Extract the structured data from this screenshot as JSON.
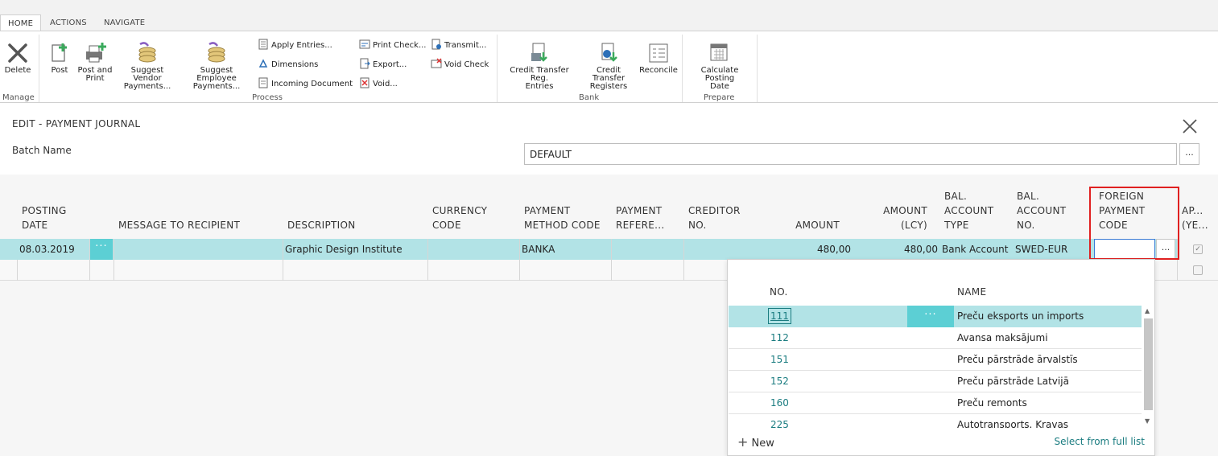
{
  "ribbon": {
    "tabs": [
      {
        "label": "HOME",
        "active": true
      },
      {
        "label": "ACTIONS",
        "active": false
      },
      {
        "label": "NAVIGATE",
        "active": false
      }
    ],
    "groups": {
      "manage": "Manage",
      "process": "Process",
      "bank": "Bank",
      "prepare": "Prepare"
    },
    "buttons": {
      "delete": "Delete",
      "post": "Post",
      "post_and_print_1": "Post and",
      "post_and_print_2": "Print",
      "suggest_vendor_1": "Suggest Vendor",
      "suggest_vendor_2": "Payments...",
      "suggest_employee_1": "Suggest Employee",
      "suggest_employee_2": "Payments...",
      "apply_entries": "Apply Entries...",
      "dimensions": "Dimensions",
      "incoming_document": "Incoming Document",
      "print_check": "Print Check...",
      "export": "Export...",
      "void": "Void...",
      "transmit": "Transmit...",
      "void_check": "Void Check",
      "credit_transfer_reg_entries_1": "Credit Transfer Reg.",
      "credit_transfer_reg_entries_2": "Entries",
      "credit_transfer_registers_1": "Credit Transfer",
      "credit_transfer_registers_2": "Registers",
      "reconcile": "Reconcile",
      "calculate_posting_date_1": "Calculate Posting",
      "calculate_posting_date_2": "Date"
    }
  },
  "page": {
    "title": "EDIT - PAYMENT JOURNAL",
    "batch_label": "Batch Name",
    "batch_value": "DEFAULT",
    "lookup_label": "..."
  },
  "grid": {
    "headers": {
      "posting_date_1": "POSTING",
      "posting_date_2": "DATE",
      "message": "MESSAGE TO RECIPIENT",
      "description": "DESCRIPTION",
      "currency_1": "CURRENCY",
      "currency_2": "CODE",
      "payment_method_1": "PAYMENT",
      "payment_method_2": "METHOD CODE",
      "payment_ref_1": "PAYMENT",
      "payment_ref_2": "REFERE...",
      "creditor_1": "CREDITOR",
      "creditor_2": "NO.",
      "amount": "AMOUNT",
      "amount_lcy_1": "AMOUNT",
      "amount_lcy_2": "(LCY)",
      "bal_type_1": "BAL.",
      "bal_type_2": "ACCOUNT",
      "bal_type_3": "TYPE",
      "bal_no_1": "BAL.",
      "bal_no_2": "ACCOUNT",
      "bal_no_3": "NO.",
      "fpc_1": "FOREIGN",
      "fpc_2": "PAYMENT",
      "fpc_3": "CODE",
      "ap_1": "AP...",
      "ap_2": "(YE..."
    },
    "row": {
      "posting_date": "08.03.2019",
      "dots": "···",
      "description": "Graphic Design Institute",
      "payment_method": "BANKA",
      "amount": "480,00",
      "amount_lcy": "480,00",
      "bal_account_type": "Bank Account",
      "bal_account_no": "SWED-EUR",
      "approved": true
    }
  },
  "dropdown": {
    "header_no": "NO.",
    "header_name": "NAME",
    "dots": "···",
    "items": [
      {
        "no": "111",
        "name": "Preču eksports un imports"
      },
      {
        "no": "112",
        "name": "Avansa maksājumi"
      },
      {
        "no": "151",
        "name": "Preču pārstrāde ārvalstīs"
      },
      {
        "no": "152",
        "name": "Preču pārstrāde Latvijā"
      },
      {
        "no": "160",
        "name": "Preču remonts"
      },
      {
        "no": "225",
        "name": "Autotransports. Kravas"
      }
    ],
    "new_label": "New",
    "full_list_label": "Select from full list"
  },
  "colors": {
    "accent": "#5ccfd4",
    "selected_row": "#b2e3e6",
    "link": "#1a7c80",
    "highlight_box": "#e02020"
  }
}
